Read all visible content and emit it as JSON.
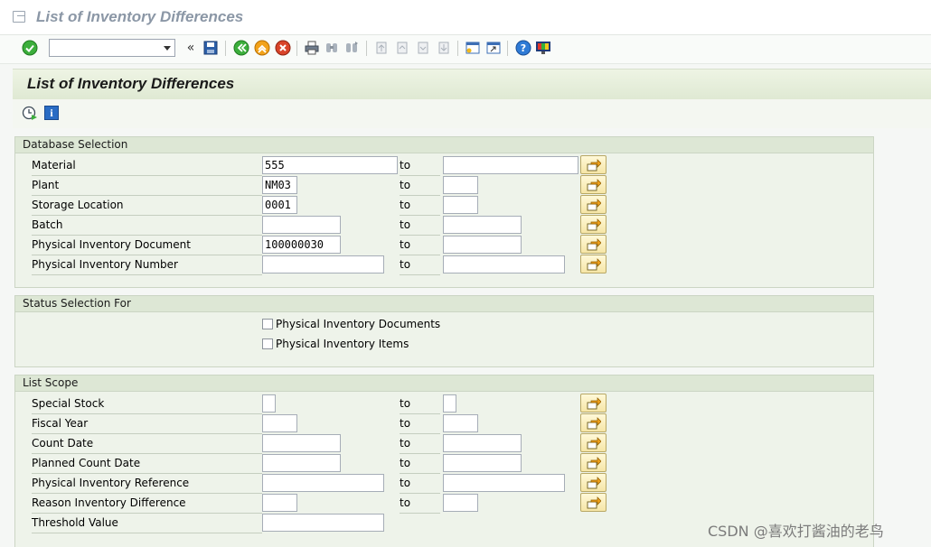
{
  "window": {
    "title": "List of Inventory Differences"
  },
  "toolbar": {
    "command_field": {
      "value": "",
      "placeholder": ""
    },
    "icons": [
      "enter-icon",
      "collapse-icon",
      "save-icon",
      "back-icon",
      "exit-icon",
      "cancel-icon",
      "print-icon",
      "find-icon",
      "find-next-icon",
      "first-page-icon",
      "previous-page-icon",
      "next-page-icon",
      "last-page-icon",
      "create-session-icon",
      "shortcut-icon",
      "help-icon",
      "customize-layout-icon"
    ],
    "collapse_glyph": "«"
  },
  "screen": {
    "title": "List of Inventory Differences"
  },
  "app_toolbar": {
    "icons": [
      "execute-icon",
      "info-icon"
    ],
    "info_glyph": "i"
  },
  "database_selection": {
    "title": "Database Selection",
    "to_label": "to",
    "rows": [
      {
        "label": "Material",
        "from": "555",
        "to": ""
      },
      {
        "label": "Plant",
        "from": "NM03",
        "to": ""
      },
      {
        "label": "Storage Location",
        "from": "0001",
        "to": ""
      },
      {
        "label": "Batch",
        "from": "",
        "to": ""
      },
      {
        "label": "Physical Inventory Document",
        "from": "100000030",
        "to": ""
      },
      {
        "label": "Physical Inventory Number",
        "from": "",
        "to": ""
      }
    ]
  },
  "status_selection": {
    "title": "Status Selection For",
    "checkboxes": [
      {
        "label": "Physical Inventory Documents",
        "checked": false
      },
      {
        "label": "Physical Inventory Items",
        "checked": false
      }
    ]
  },
  "list_scope": {
    "title": "List Scope",
    "to_label": "to",
    "rows": [
      {
        "label": "Special Stock",
        "from": "",
        "to": ""
      },
      {
        "label": "Fiscal Year",
        "from": "",
        "to": ""
      },
      {
        "label": "Count Date",
        "from": "",
        "to": ""
      },
      {
        "label": "Planned Count Date",
        "from": "",
        "to": ""
      },
      {
        "label": "Physical Inventory Reference",
        "from": "",
        "to": ""
      },
      {
        "label": "Reason Inventory Difference",
        "from": "",
        "to": ""
      },
      {
        "label": "Threshold Value",
        "from": ""
      }
    ]
  },
  "watermark": {
    "text": "CSDN @喜欢打酱油的老鸟"
  },
  "colors": {
    "header_green": "#dde7d5",
    "multi_button": "#f6e6a6",
    "enter_green": "#3cae3c",
    "exit_orange": "#f2a21a",
    "cancel_red": "#d9442a",
    "help_blue": "#2f7bd6"
  }
}
